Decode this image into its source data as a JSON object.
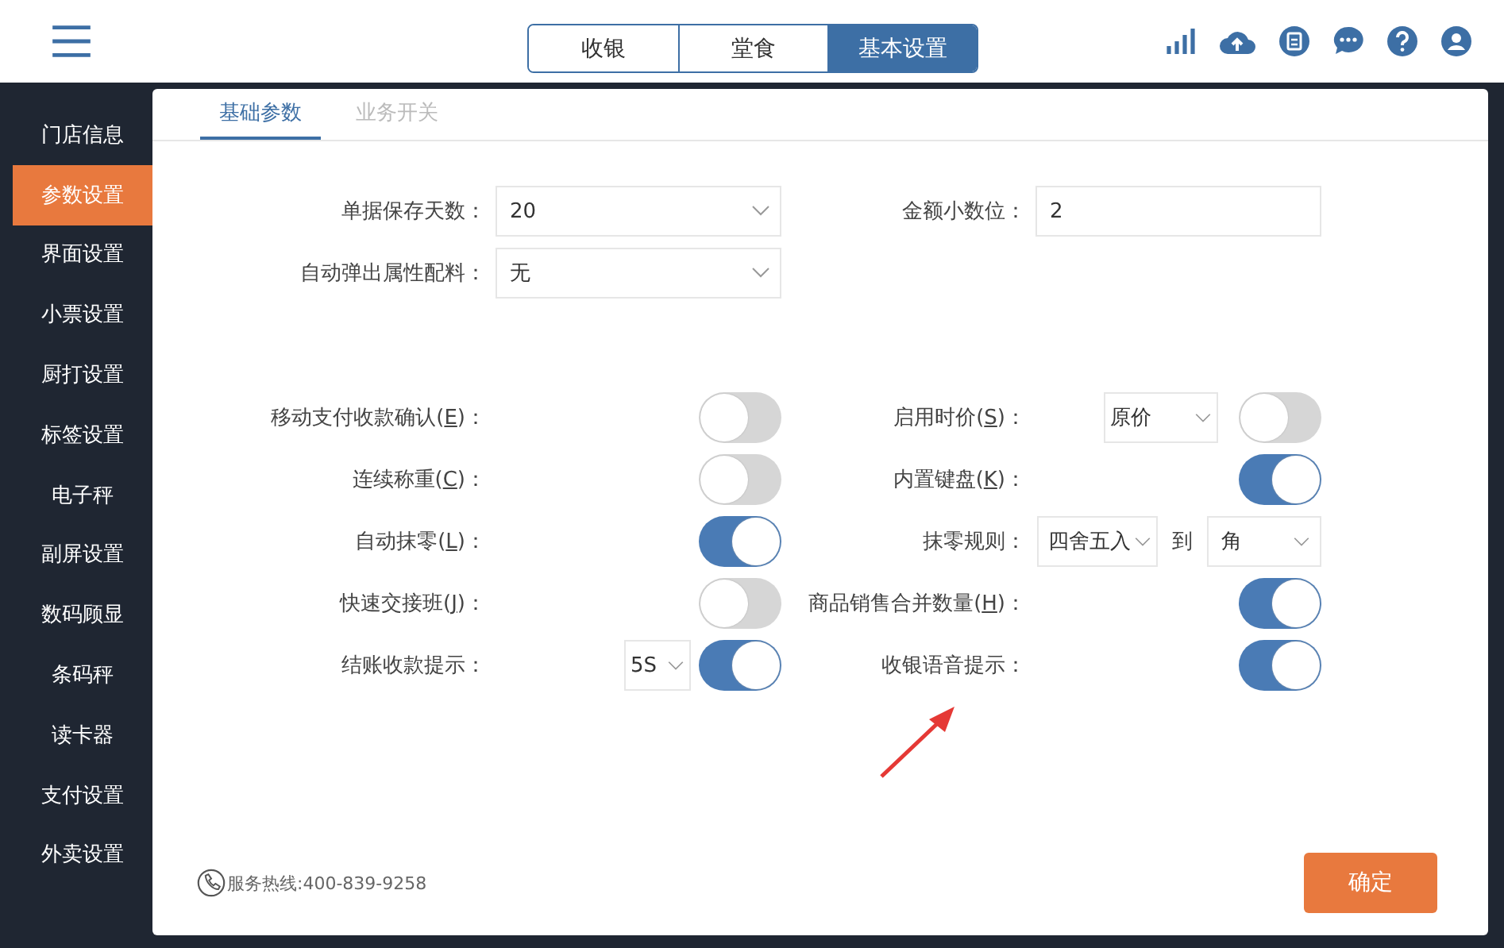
{
  "top_tabs": [
    {
      "label": "收银",
      "selected": false
    },
    {
      "label": "堂食",
      "selected": false
    },
    {
      "label": "基本设置",
      "selected": true
    }
  ],
  "sidebar": {
    "items": [
      {
        "label": "门店信息",
        "selected": false
      },
      {
        "label": "参数设置",
        "selected": true
      },
      {
        "label": "界面设置",
        "selected": false
      },
      {
        "label": "小票设置",
        "selected": false
      },
      {
        "label": "厨打设置",
        "selected": false
      },
      {
        "label": "标签设置",
        "selected": false
      },
      {
        "label": "电子秤",
        "selected": false
      },
      {
        "label": "副屏设置",
        "selected": false
      },
      {
        "label": "数码顾显",
        "selected": false
      },
      {
        "label": "条码秤",
        "selected": false
      },
      {
        "label": "读卡器",
        "selected": false
      },
      {
        "label": "支付设置",
        "selected": false
      },
      {
        "label": "外卖设置",
        "selected": false
      }
    ]
  },
  "sub_tabs": [
    {
      "label": "基础参数",
      "selected": true
    },
    {
      "label": "业务开关",
      "selected": false
    }
  ],
  "fields_left": [
    {
      "label": "单据保存天数：",
      "value": "20",
      "kind": "select"
    },
    {
      "label": "自动弹出属性配料：",
      "value": "无",
      "kind": "select"
    }
  ],
  "fields_right": [
    {
      "label": "金额小数位：",
      "value": "2",
      "kind": "input"
    }
  ],
  "switches_left": [
    {
      "kind": "toggle",
      "label": "移动支付收款确认(",
      "hotkey": "E",
      "label_end": ")：",
      "on": false
    },
    {
      "kind": "toggle",
      "label": "连续称重(",
      "hotkey": "C",
      "label_end": ")：",
      "on": false
    },
    {
      "kind": "toggle",
      "label": "自动抹零(",
      "hotkey": "L",
      "label_end": ")：",
      "on": true
    },
    {
      "kind": "toggle",
      "label": "快速交接班(",
      "hotkey": "J",
      "label_end": ")：",
      "on": false
    },
    {
      "kind": "select_toggle",
      "label": "结账收款提示：",
      "select": "5S",
      "on": true
    }
  ],
  "switches_right": [
    {
      "kind": "select_toggle",
      "label": "启用时价(",
      "hotkey": "S",
      "label_end": ")：",
      "select": "原价",
      "on": false
    },
    {
      "kind": "toggle",
      "label": "内置键盘(",
      "hotkey": "K",
      "label_end": ")：",
      "on": true
    },
    {
      "kind": "select_pair",
      "label": "抹零规则：",
      "select": "四舍五入",
      "joiner": "到",
      "select2": "角"
    },
    {
      "kind": "toggle",
      "label": "商品销售合并数量(",
      "hotkey": "H",
      "label_end": ")：",
      "on": true
    },
    {
      "kind": "toggle",
      "label": "收银语音提示：",
      "on": true
    }
  ],
  "hotline": "服务热线:400-839-9258",
  "confirm_button": "确定"
}
